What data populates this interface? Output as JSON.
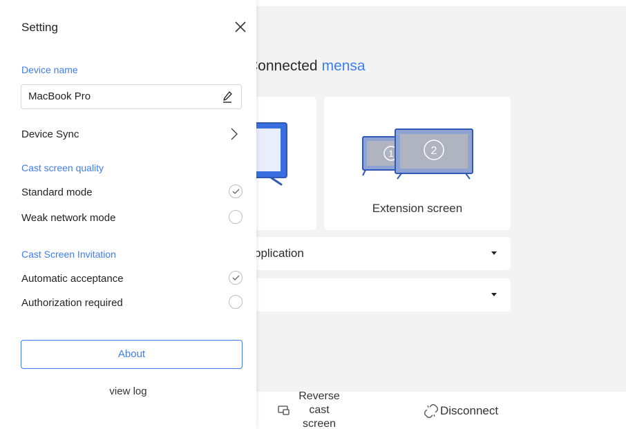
{
  "main": {
    "title_prefix": "Connected",
    "device_name": "mensa",
    "cards": [
      {
        "label": ""
      },
      {
        "label": "Extension screen",
        "badges": [
          "1",
          "2"
        ]
      }
    ],
    "dropdowns": [
      {
        "value": "pplication"
      },
      {
        "value": ""
      }
    ],
    "bottom_bar": {
      "reverse_label_lines": [
        "Reverse",
        "cast",
        "screen"
      ],
      "disconnect_label": "Disconnect"
    },
    "colors": {
      "accent": "#3d7df0",
      "monitor_fill": "#8fa3d3",
      "monitor_frame": "#2f58b8",
      "screen_fill": "#b0b4c0"
    }
  },
  "settings": {
    "title": "Setting",
    "device_name_heading": "Device name",
    "device_name_value": "MacBook Pro",
    "device_sync_label": "Device Sync",
    "quality_heading": "Cast screen quality",
    "quality_options": [
      {
        "label": "Standard mode",
        "selected": true
      },
      {
        "label": "Weak network mode",
        "selected": false
      }
    ],
    "invitation_heading": "Cast Screen Invitation",
    "invitation_options": [
      {
        "label": "Automatic acceptance",
        "selected": true
      },
      {
        "label": "Authorization required",
        "selected": false
      }
    ],
    "about_label": "About",
    "view_log_label": "view log",
    "icons": [
      "close-icon",
      "pencil-icon",
      "chevron-right-icon",
      "check-icon"
    ]
  }
}
